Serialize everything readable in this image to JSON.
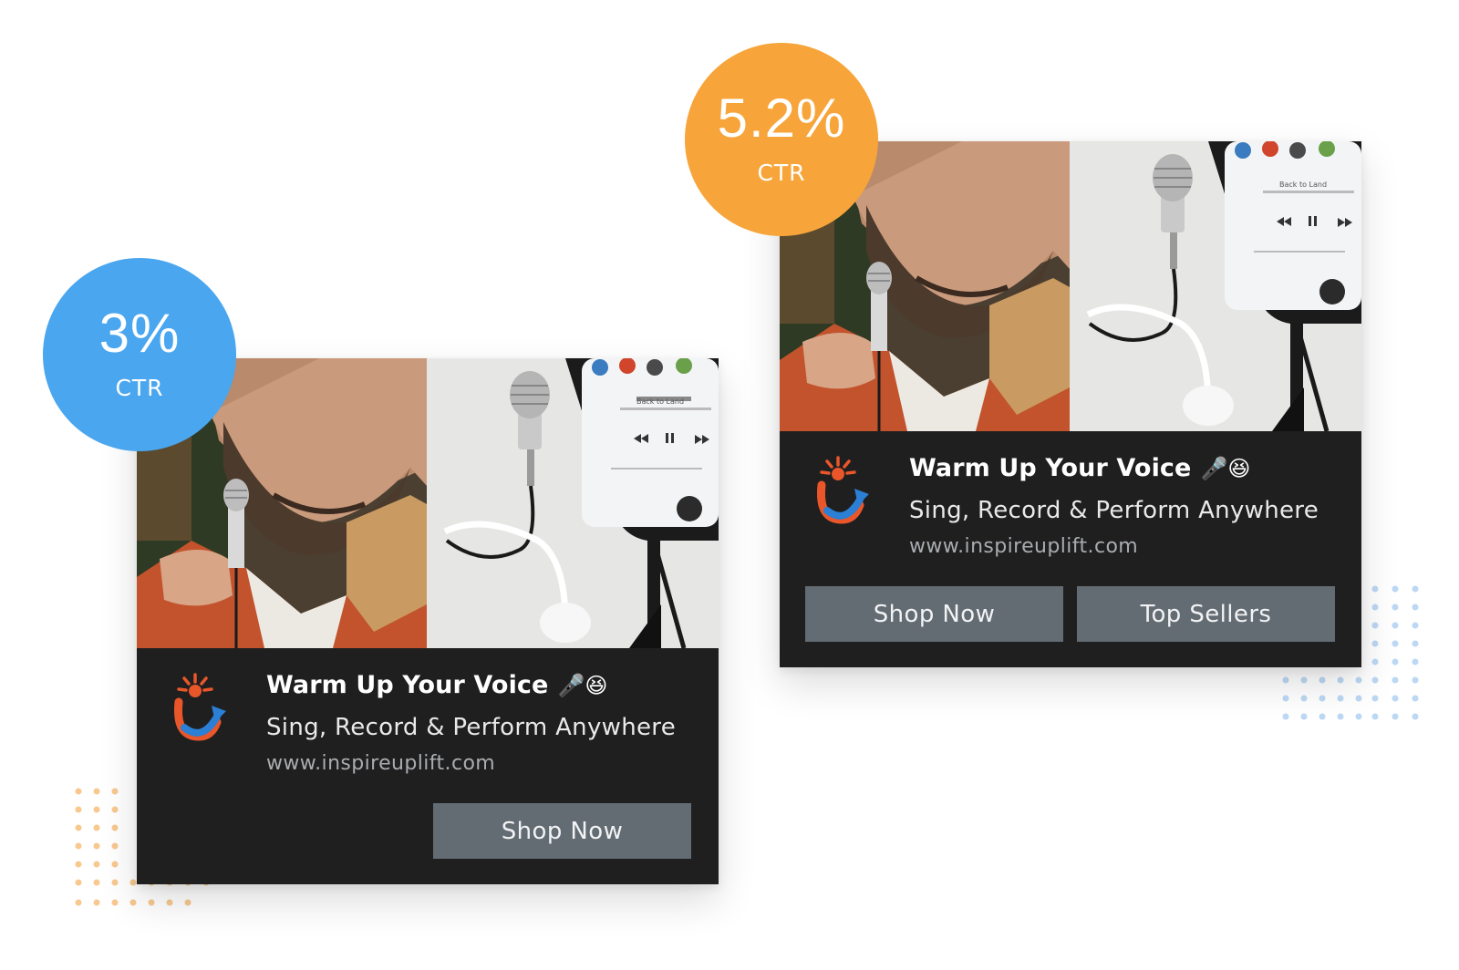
{
  "badges": [
    {
      "value": "3%",
      "label": "CTR",
      "color": "#4aa6ef"
    },
    {
      "value": "5.2%",
      "label": "CTR",
      "color": "#f7a53b"
    }
  ],
  "ads": [
    {
      "title": "Warm Up Your Voice",
      "title_emoji": "🎤😆",
      "subtitle": "Sing, Record & Perform Anywhere",
      "url": "www.inspireuplift.com",
      "buttons": [
        "Shop Now"
      ]
    },
    {
      "title": "Warm Up Your Voice",
      "title_emoji": "🎤😆",
      "subtitle": "Sing, Record & Perform Anywhere",
      "url": "www.inspireuplift.com",
      "buttons": [
        "Shop Now",
        "Top Sellers"
      ]
    }
  ],
  "photo": {
    "phone_track": "Back to Land"
  },
  "colors": {
    "ad_background": "#1f1f20",
    "button": "#636b73",
    "dots_orange": "#f7c98f",
    "dots_blue": "#bcd8f4"
  },
  "icons": [
    "inspireuplift-logo-icon",
    "microphone-emoji-icon",
    "laughing-emoji-icon"
  ]
}
